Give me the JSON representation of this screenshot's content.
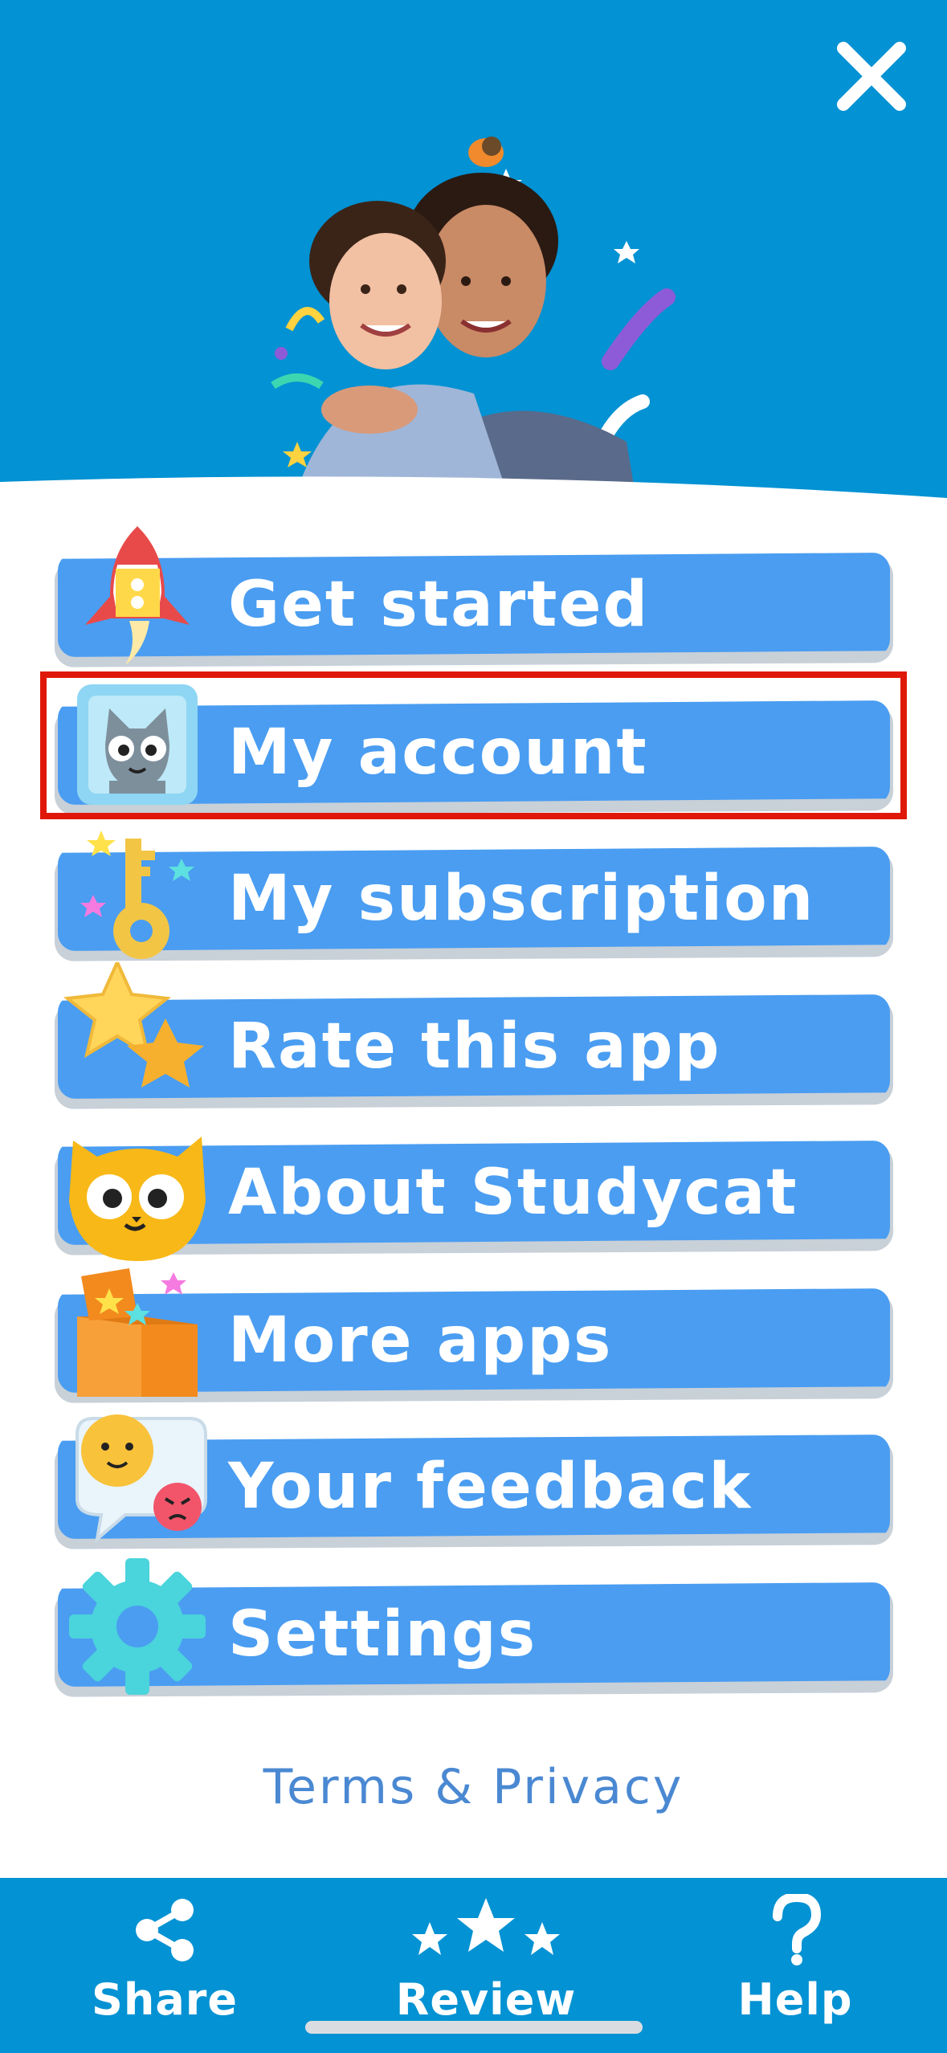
{
  "header": {
    "close_label": "Close",
    "hero_alt": "Child hugging adult"
  },
  "menu": {
    "items": [
      {
        "label": "Get started",
        "icon": "rocket-icon"
      },
      {
        "label": "My account",
        "icon": "cat-avatar-icon"
      },
      {
        "label": "My subscription",
        "icon": "key-icon"
      },
      {
        "label": "Rate this app",
        "icon": "stars-icon"
      },
      {
        "label": "About Studycat",
        "icon": "studycat-face-icon"
      },
      {
        "label": "More apps",
        "icon": "box-icon"
      },
      {
        "label": "Your feedback",
        "icon": "feedback-bubble-icon"
      },
      {
        "label": "Settings",
        "icon": "gear-icon"
      }
    ],
    "highlighted_index": 1
  },
  "footer": {
    "terms_label": "Terms & Privacy"
  },
  "bottom_bar": {
    "share_label": "Share",
    "review_label": "Review",
    "help_label": "Help"
  },
  "colors": {
    "header_blue": "#0392d3",
    "button_blue": "#4a9df1",
    "highlight_red": "#e0180a",
    "link_blue": "#4a88d2"
  }
}
